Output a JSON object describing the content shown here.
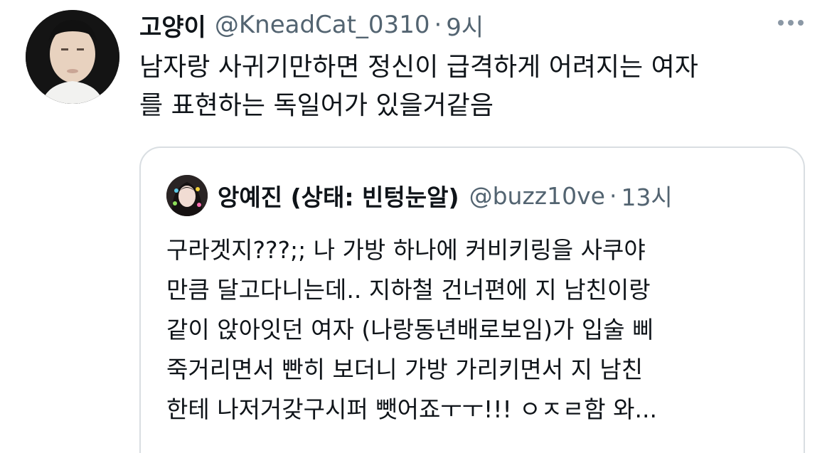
{
  "tweet": {
    "display_name": "고양이",
    "handle": "@KneadCat_0310",
    "separator": "·",
    "time": "9시",
    "text_lines": [
      "남자랑 사귀기만하면 정신이 급격하게 어려지는 여자",
      "를 표현하는 독일어가 있을거같음"
    ],
    "more_icon": "more-horizontal-icon"
  },
  "quote": {
    "display_name": "앙예진 (상태: 빈텅눈알)",
    "handle": "@buzz10ve",
    "separator": "·",
    "time": "13시",
    "text_lines": [
      "구라겟지???;; 나 가방 하나에 커비키링을 사쿠야",
      "만큼 달고다니는데.. 지하철 건너편에 지 남친이랑",
      "같이 앉아잇던 여자 (나랑동년배로보임)가 입술 삐",
      "죽거리면서 빤히 보더니 가방 가리키면서  지 남친",
      "한테 나저거갖구시퍼 뺏어죠ㅜㅜ!!! ㅇㅈㄹ함 와..."
    ]
  }
}
